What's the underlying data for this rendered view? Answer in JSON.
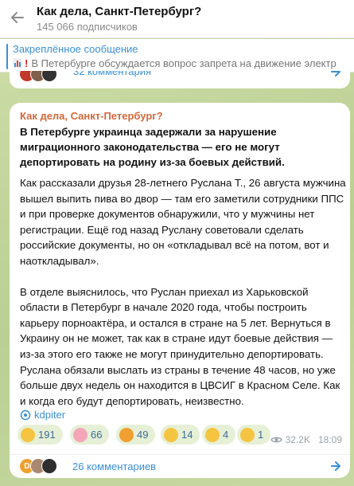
{
  "header": {
    "title": "Как дела, Санкт-Петербург?",
    "subscribers": "145 066 подписчиков"
  },
  "pinned": {
    "title": "Закреплённое сообщение",
    "text": "В Петербурге обсуждается вопрос запрета на движение электр"
  },
  "prev_comments": {
    "label": "32 комментария"
  },
  "post": {
    "channel": "Как дела, Санкт-Петербург?",
    "headline": "В Петербурге украинца задержали за нарушение миграционного законодательства — его не могут депортировать на родину из-за боевых действий.",
    "paragraph1": "Как рассказали друзья 28-летнего Руслана Т., 26 августа мужчина вышел выпить пива во двор — там его заметили сотрудники ППС и при проверке документов обнаружили, что у мужчины нет регистрации. Ещё год назад Руслану советовали сделать российские документы, но он «откладывал всё на потом, вот и наоткладывал».",
    "paragraph2": "В отделе выяснилось, что Руслан приехал из Харьковской области в Петербург в начале 2020 года, чтобы построить карьеру порноактёра, и остался в стране на 5 лет. Вернуться в Украину он не может, так как в стране идут боевые действия — из-за этого его также не могут принудительно депортировать. Руслана обязали выслать из страны в течение 48 часов, но уже больше двух недель он находится в ЦВСИГ в Красном Селе. Как и когда его будут депортировать, неизвестно.",
    "source": "kdpiter",
    "reactions": [
      {
        "emoji": "grinning-face",
        "count": "191",
        "color": "#f5c542"
      },
      {
        "emoji": "pig-face",
        "count": "66",
        "color": "#f4a6b8"
      },
      {
        "emoji": "exploding-head",
        "count": "49",
        "color": "#f0a030"
      },
      {
        "emoji": "crying-face",
        "count": "14",
        "color": "#f5c542"
      },
      {
        "emoji": "thumbs-up",
        "count": "4",
        "color": "#f5c542"
      },
      {
        "emoji": "thumbs-down",
        "count": "1",
        "color": "#f5c542"
      }
    ],
    "views": "32.2K",
    "time": "18:09"
  },
  "comments": {
    "label": "26 комментариев",
    "avatar_letter": "D"
  },
  "colors": {
    "accent": "#3a8fd8",
    "channel": "#d2683a",
    "bg": "#c9d9a6"
  }
}
